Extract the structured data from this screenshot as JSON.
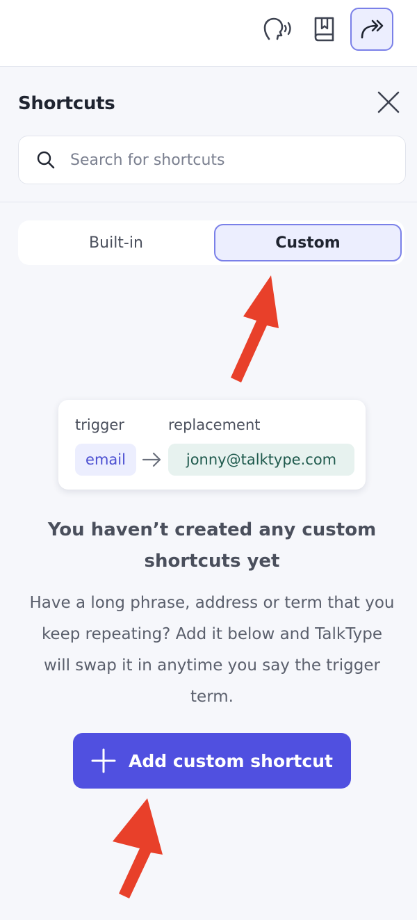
{
  "topbar": {
    "icons": [
      "voice-icon",
      "book-icon",
      "shortcuts-icon"
    ],
    "active": "shortcuts-icon"
  },
  "panel": {
    "title": "Shortcuts",
    "search_placeholder": "Search for shortcuts"
  },
  "tabs": [
    {
      "label": "Built-in",
      "selected": false
    },
    {
      "label": "Custom",
      "selected": true
    }
  ],
  "example": {
    "trigger_label": "trigger",
    "replacement_label": "replacement",
    "trigger_value": "email",
    "replacement_value": "jonny@talktype.com"
  },
  "empty_state": {
    "title": "You haven’t created any custom shortcuts yet",
    "body": "Have a long phrase, address or term that you keep repeating? Add it below and TalkType will swap it in anytime you say the trigger term."
  },
  "cta": {
    "label": "Add custom shortcut"
  },
  "colors": {
    "accent": "#5050e0",
    "accent_light": "#eceefe",
    "annotation_arrow": "#e8402a",
    "replacement_bg": "#e7f2ef"
  }
}
